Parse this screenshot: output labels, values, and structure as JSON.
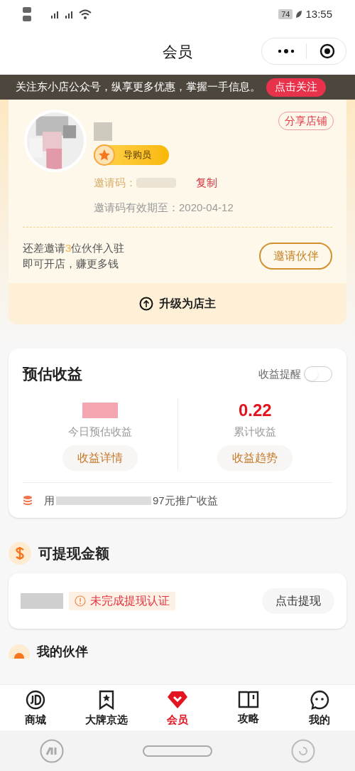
{
  "status_bar": {
    "battery": "74",
    "time": "13:55"
  },
  "header": {
    "title": "会员"
  },
  "banner": {
    "text": "关注东小店公众号，纵享更多优惠，掌握一手信息。",
    "button": "点击关注"
  },
  "member_card": {
    "share_button": "分享店铺",
    "role_badge": "导购员",
    "invite_code_label": "邀请码：",
    "copy_button": "复制",
    "expiry": "邀请码有效期至：2020-04-12",
    "invite_note_lines": [
      "还差邀请**3**位伙伴入驻",
      "即可开店，赚更多钱"
    ],
    "invite_button": "邀请伙伴",
    "upgrade": "升级为店主"
  },
  "earnings": {
    "title": "预估收益",
    "reminder": {
      "label": "收益提醒",
      "on": false
    },
    "stats": [
      {
        "label": "今日预估收益",
        "button": "收益详情"
      },
      {
        "value": "0.22",
        "label": "累计收益",
        "button": "收益趋势"
      }
    ],
    "promo_prefix": "用",
    "promo_suffix": "97元推广收益"
  },
  "withdraw": {
    "title": "可提现金额",
    "warning": "未完成提现认证",
    "button": "点击提现"
  },
  "partners": {
    "title": "我的伙伴"
  },
  "tabs": [
    {
      "label": "商城",
      "selected": false
    },
    {
      "label": "大牌京选",
      "selected": false
    },
    {
      "label": "会员",
      "selected": true
    },
    {
      "label": "攻略",
      "selected": false
    },
    {
      "label": "我的",
      "selected": false
    }
  ]
}
